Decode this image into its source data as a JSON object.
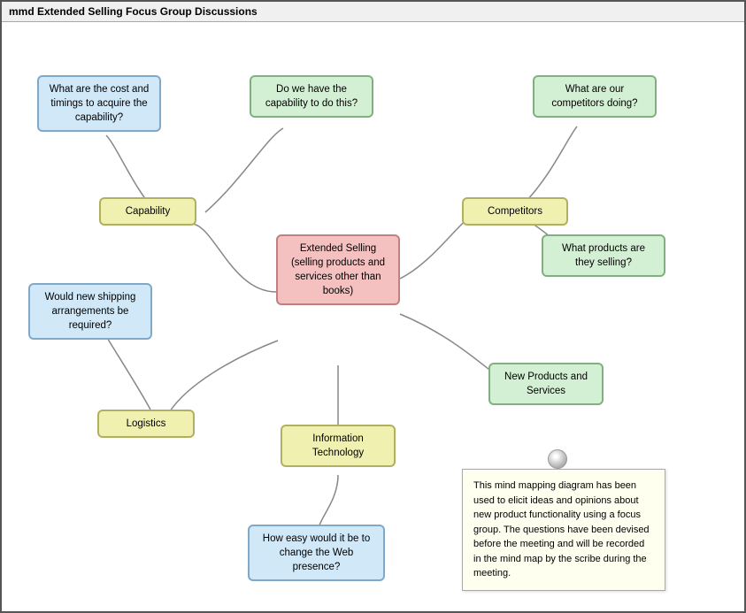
{
  "window": {
    "title": "mmd Extended Selling Focus Group Discussions"
  },
  "nodes": {
    "center": {
      "label": "Extended Selling (selling products and services other than books)"
    },
    "capability": {
      "label": "Capability"
    },
    "competitors": {
      "label": "Competitors"
    },
    "logistics": {
      "label": "Logistics"
    },
    "information_technology": {
      "label": "Information Technology"
    },
    "new_products": {
      "label": "New Products and Services"
    },
    "q1": {
      "label": "What are the cost and timings to acquire the capability?"
    },
    "q2": {
      "label": "Do we have the capability to do this?"
    },
    "q3": {
      "label": "What are our competitors doing?"
    },
    "q4": {
      "label": "What products are they selling?"
    },
    "q5": {
      "label": "Would new shipping arrangements be required?"
    },
    "q6": {
      "label": "How easy would it be to change the Web presence?"
    }
  },
  "note": {
    "text": "This mind mapping diagram has been used to elicit ideas and opinions about new product functionality using a focus group. The questions have been devised before the meeting and will be recorded in the mind map by the scribe during the meeting."
  }
}
